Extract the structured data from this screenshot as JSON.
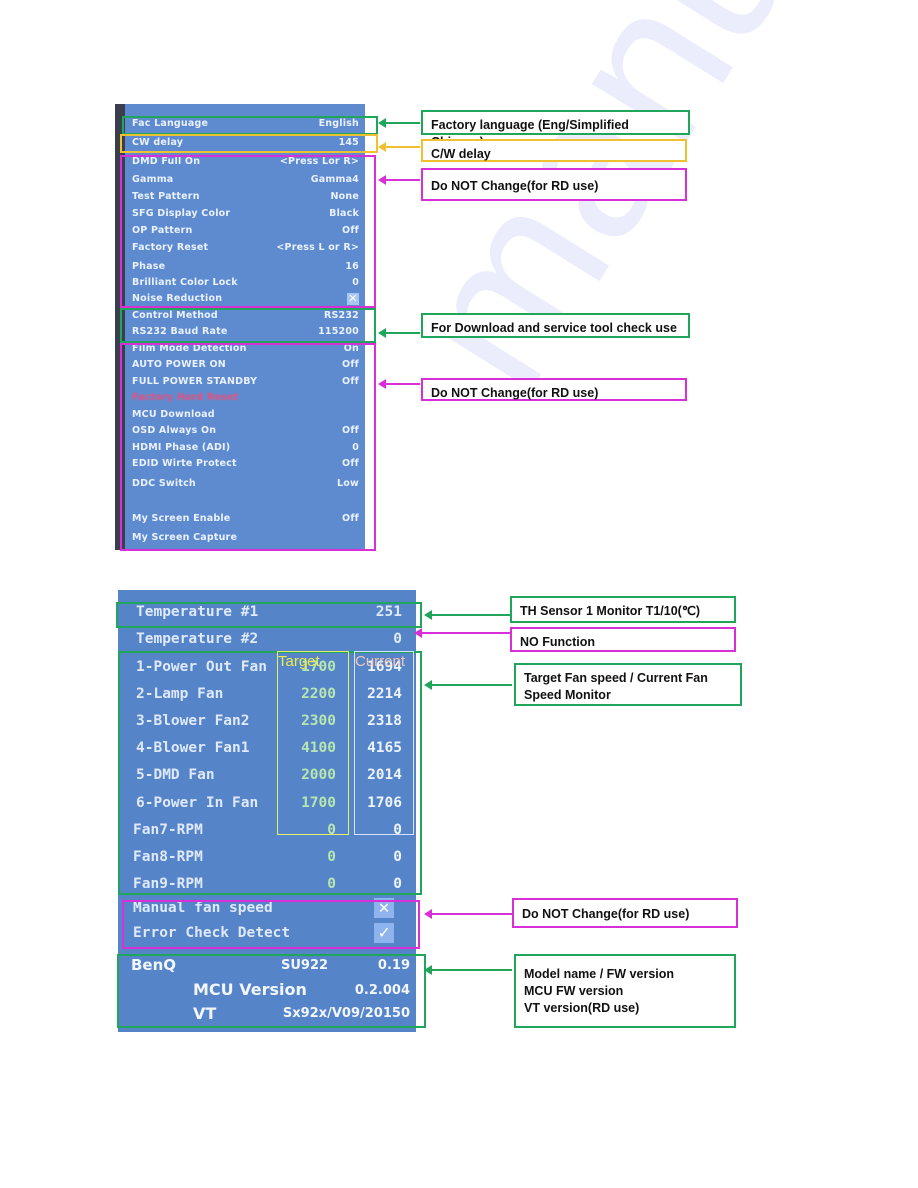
{
  "watermark": "manualslib",
  "factory_menu": {
    "rows": [
      {
        "label": "Fac Language",
        "value": "English"
      },
      {
        "label": "CW delay",
        "value": "145"
      },
      {
        "label": "DMD Full On",
        "value": "<Press Lor R>"
      },
      {
        "label": "Gamma",
        "value": "Gamma4"
      },
      {
        "label": "Test Pattern",
        "value": "None"
      },
      {
        "label": "SFG Display Color",
        "value": "Black"
      },
      {
        "label": "OP Pattern",
        "value": "Off"
      },
      {
        "label": "Factory Reset",
        "value": "<Press L or R>"
      },
      {
        "label": "Phase",
        "value": "16"
      },
      {
        "label": "Brilliant Color Lock",
        "value": "0"
      },
      {
        "label": "Noise Reduction",
        "value": "✕"
      },
      {
        "label": "Control Method",
        "value": "RS232"
      },
      {
        "label": "RS232 Baud Rate",
        "value": "115200"
      },
      {
        "label": "Film Mode Detection",
        "value": "On"
      },
      {
        "label": "AUTO POWER ON",
        "value": "Off"
      },
      {
        "label": "FULL POWER STANDBY",
        "value": "Off"
      },
      {
        "label": "Factory Hard Reset",
        "value": ""
      },
      {
        "label": "MCU Download",
        "value": ""
      },
      {
        "label": "OSD Always On",
        "value": "Off"
      },
      {
        "label": "HDMI Phase (ADI)",
        "value": "0"
      },
      {
        "label": "EDID Wirte Protect",
        "value": "Off"
      },
      {
        "label": "DDC Switch",
        "value": "Low"
      },
      {
        "label": "My Screen Enable",
        "value": "Off"
      },
      {
        "label": "My Screen Capture",
        "value": ""
      }
    ],
    "callouts": {
      "fac_language": "Factory language (Eng/Simplified Chinese)",
      "cw_delay": "C/W delay",
      "do_not_change_1": "Do NOT Change(for RD use)",
      "download_check": "For Download and service tool check use",
      "do_not_change_2": "Do NOT Change(for RD use)"
    }
  },
  "fan_menu": {
    "temperature": [
      {
        "label": "Temperature #1",
        "value": "251"
      },
      {
        "label": "Temperature #2",
        "value": "0"
      }
    ],
    "column_headers": {
      "target": "Target",
      "current": "Current"
    },
    "fans": [
      {
        "label": "1-Power Out Fan",
        "target": "1700",
        "current": "1694"
      },
      {
        "label": "2-Lamp Fan",
        "target": "2200",
        "current": "2214"
      },
      {
        "label": "3-Blower Fan2",
        "target": "2300",
        "current": "2318"
      },
      {
        "label": "4-Blower Fan1",
        "target": "4100",
        "current": "4165"
      },
      {
        "label": "5-DMD Fan",
        "target": "2000",
        "current": "2014"
      },
      {
        "label": "6-Power In Fan",
        "target": "1700",
        "current": "1706"
      },
      {
        "label": "Fan7-RPM",
        "target": "0",
        "current": "0"
      },
      {
        "label": "Fan8-RPM",
        "target": "0",
        "current": "0"
      },
      {
        "label": "Fan9-RPM",
        "target": "0",
        "current": "0"
      }
    ],
    "toggles": [
      {
        "label": "Manual fan speed",
        "state": "✕"
      },
      {
        "label": "Error Check Detect",
        "state": "✓"
      }
    ],
    "version": {
      "brand": "BenQ",
      "model": "SU922",
      "fw_version": "0.19",
      "mcu_label": "MCU Version",
      "mcu_version": "0.2.004",
      "vt_label": "VT",
      "vt_version": "Sx92x/V09/20150"
    },
    "callouts": {
      "th_sensor": "TH Sensor 1 Monitor   T1/10(℃)",
      "no_function": "NO Function",
      "fan_speed": "Target Fan speed / Current Fan Speed Monitor",
      "do_not_change": "Do NOT Change(for RD use)",
      "versions": [
        "Model name / FW version",
        "MCU FW version",
        "VT version(RD use)"
      ]
    }
  },
  "colors": {
    "green": "#1fa65a",
    "yellow": "#f0c030",
    "magenta": "#d92fd9",
    "osd_blue": "#5e8bd0"
  }
}
